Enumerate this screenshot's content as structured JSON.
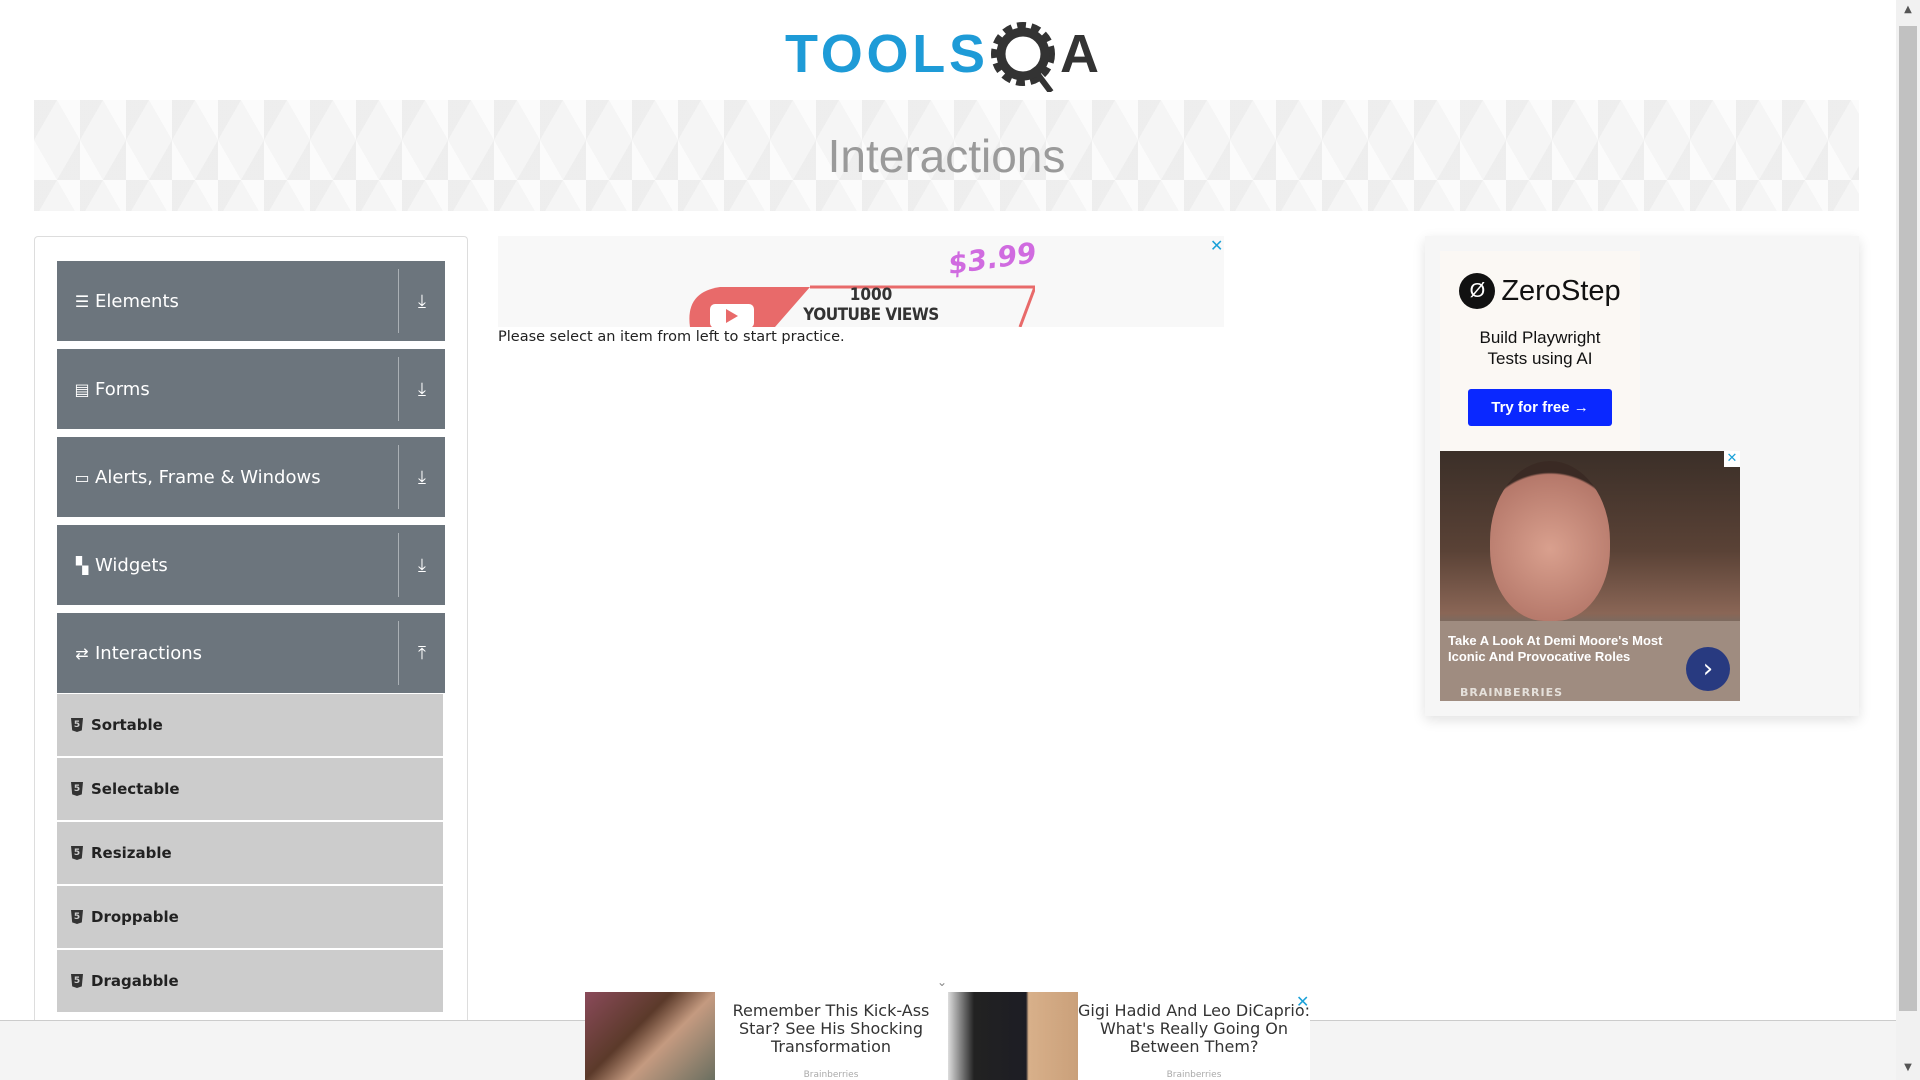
{
  "logo": {
    "text_tools": "TOOLS",
    "text_qa": "QA"
  },
  "header": {
    "title": "Interactions"
  },
  "sidebar": {
    "groups": [
      {
        "label": "Elements",
        "icon": "menu-icon",
        "state": "collapsed"
      },
      {
        "label": "Forms",
        "icon": "form-icon",
        "state": "collapsed"
      },
      {
        "label": "Alerts, Frame & Windows",
        "icon": "window-icon",
        "state": "collapsed"
      },
      {
        "label": "Widgets",
        "icon": "widgets-icon",
        "state": "collapsed"
      },
      {
        "label": "Interactions",
        "icon": "interactions-icon",
        "state": "expanded"
      }
    ],
    "items": [
      {
        "label": "Sortable"
      },
      {
        "label": "Selectable"
      },
      {
        "label": "Resizable"
      },
      {
        "label": "Droppable"
      },
      {
        "label": "Dragabble"
      }
    ]
  },
  "main": {
    "prompt": "Please select an item from left to start practice."
  },
  "center_ad": {
    "count": "1000",
    "label": "YOUTUBE VIEWS",
    "price": "$3.99",
    "close": "✕"
  },
  "right_ad": {
    "brand": "ZeroStep",
    "tagline_1": "Build Playwright",
    "tagline_2": "Tests using AI",
    "cta": "Try for free →",
    "promo_title": "Take A Look At Demi Moore's Most Iconic And Provocative Roles",
    "promo_source": "BRAINBERRIES",
    "close": "✕"
  },
  "bottom_ads": [
    {
      "title": "Remember This Kick-Ass Star? See His Shocking Transformation",
      "source": "Brainberries"
    },
    {
      "title": "Gigi Hadid And Leo DiCaprio: What's Really Going On Between Them?",
      "source": "Brainberries"
    }
  ],
  "bottom_close": "✕",
  "colors": {
    "brand_blue": "#1e9bd7",
    "sidebar_header": "#6c757d",
    "sidebar_item": "#cccccc",
    "cta": "#0a28ff"
  }
}
